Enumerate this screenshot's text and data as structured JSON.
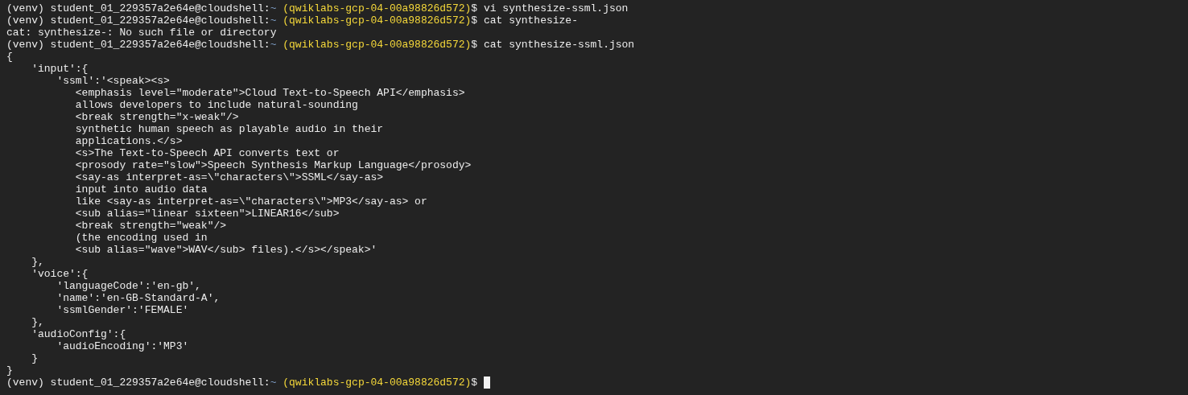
{
  "terminal": {
    "lines": [
      {
        "kind": "prompt",
        "env": "(venv)",
        "user_host": "student_01_229357a2e64e@cloudshell:",
        "path": "~",
        "project": "(qwiklabs-gcp-04-00a98826d572)",
        "symbol": "$",
        "command": "vi synthesize-ssml.json",
        "cursor": false
      },
      {
        "kind": "prompt",
        "env": "(venv)",
        "user_host": "student_01_229357a2e64e@cloudshell:",
        "path": "~",
        "project": "(qwiklabs-gcp-04-00a98826d572)",
        "symbol": "$",
        "command": "cat synthesize-",
        "cursor": false
      },
      {
        "kind": "output",
        "text": "cat: synthesize-: No such file or directory"
      },
      {
        "kind": "prompt",
        "env": "(venv)",
        "user_host": "student_01_229357a2e64e@cloudshell:",
        "path": "~",
        "project": "(qwiklabs-gcp-04-00a98826d572)",
        "symbol": "$",
        "command": "cat synthesize-ssml.json",
        "cursor": false
      },
      {
        "kind": "output",
        "text": "{"
      },
      {
        "kind": "output",
        "text": "    'input':{"
      },
      {
        "kind": "output",
        "text": "        'ssml':'<speak><s>"
      },
      {
        "kind": "output",
        "text": "           <emphasis level=\"moderate\">Cloud Text-to-Speech API</emphasis>"
      },
      {
        "kind": "output",
        "text": "           allows developers to include natural-sounding"
      },
      {
        "kind": "output",
        "text": "           <break strength=\"x-weak\"/>"
      },
      {
        "kind": "output",
        "text": "           synthetic human speech as playable audio in their"
      },
      {
        "kind": "output",
        "text": "           applications.</s>"
      },
      {
        "kind": "output",
        "text": "           <s>The Text-to-Speech API converts text or"
      },
      {
        "kind": "output",
        "text": "           <prosody rate=\"slow\">Speech Synthesis Markup Language</prosody>"
      },
      {
        "kind": "output",
        "text": "           <say-as interpret-as=\\\"characters\\\">SSML</say-as>"
      },
      {
        "kind": "output",
        "text": "           input into audio data"
      },
      {
        "kind": "output",
        "text": "           like <say-as interpret-as=\\\"characters\\\">MP3</say-as> or"
      },
      {
        "kind": "output",
        "text": "           <sub alias=\"linear sixteen\">LINEAR16</sub>"
      },
      {
        "kind": "output",
        "text": "           <break strength=\"weak\"/>"
      },
      {
        "kind": "output",
        "text": "           (the encoding used in"
      },
      {
        "kind": "output",
        "text": "           <sub alias=\"wave\">WAV</sub> files).</s></speak>'"
      },
      {
        "kind": "output",
        "text": "    },"
      },
      {
        "kind": "output",
        "text": "    'voice':{"
      },
      {
        "kind": "output",
        "text": "        'languageCode':'en-gb',"
      },
      {
        "kind": "output",
        "text": "        'name':'en-GB-Standard-A',"
      },
      {
        "kind": "output",
        "text": "        'ssmlGender':'FEMALE'"
      },
      {
        "kind": "output",
        "text": "    },"
      },
      {
        "kind": "output",
        "text": "    'audioConfig':{"
      },
      {
        "kind": "output",
        "text": "        'audioEncoding':'MP3'"
      },
      {
        "kind": "output",
        "text": "    }"
      },
      {
        "kind": "output",
        "text": "}"
      },
      {
        "kind": "prompt",
        "env": "(venv)",
        "user_host": "student_01_229357a2e64e@cloudshell:",
        "path": "~",
        "project": "(qwiklabs-gcp-04-00a98826d572)",
        "symbol": "$",
        "cursor": true
      }
    ]
  }
}
